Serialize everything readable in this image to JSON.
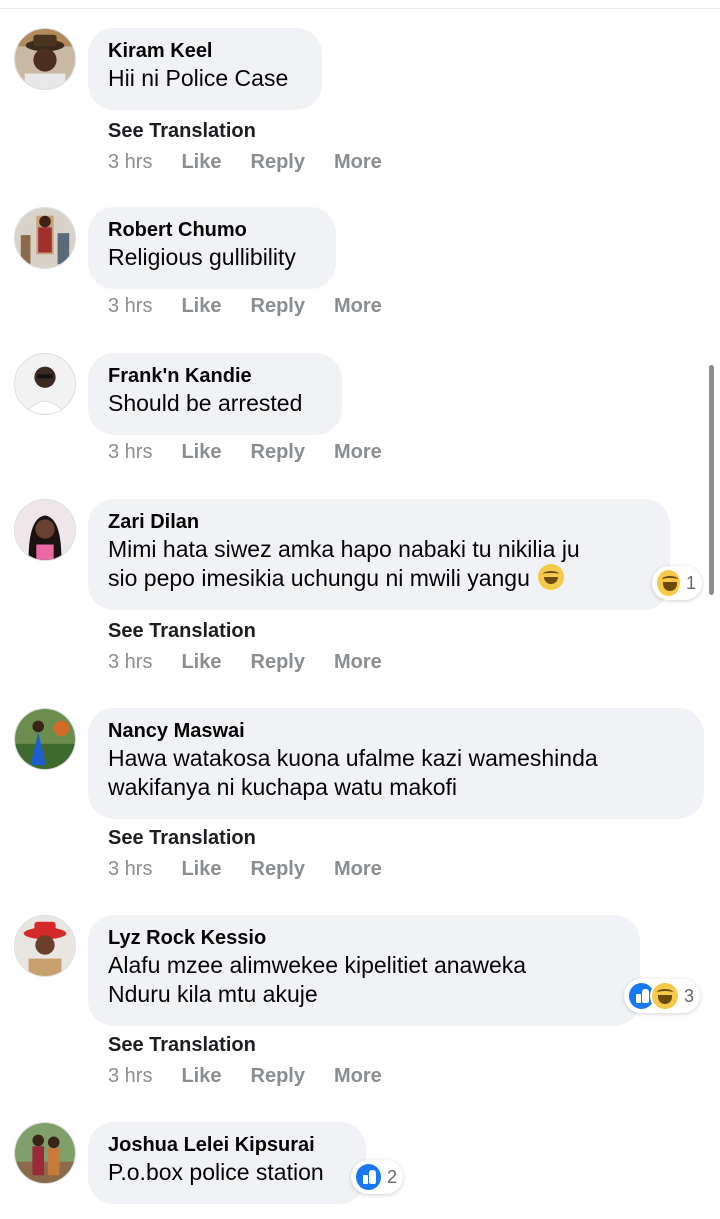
{
  "see_translation": "See Translation",
  "actions": {
    "time": "3 hrs",
    "like": "Like",
    "reply": "Reply",
    "more": "More"
  },
  "comments": [
    {
      "author": "Kiram Keel",
      "lines": [
        "Hii ni Police Case"
      ]
    },
    {
      "author": "Robert Chumo",
      "lines": [
        "Religious gullibility"
      ]
    },
    {
      "author": "Frank'n Kandie",
      "lines": [
        "Should be arrested"
      ]
    },
    {
      "author": "Zari Dilan",
      "lines": [
        "Mimi hata siwez amka hapo nabaki tu nikilia ju",
        "sio pepo imesikia uchungu ni mwili yangu"
      ],
      "emoji": "grinning-squinting-face",
      "reaction_count": "1"
    },
    {
      "author": "Nancy Maswai",
      "lines": [
        "Hawa watakosa kuona ufalme kazi wameshinda",
        "wakifanya ni kuchapa watu makofi"
      ]
    },
    {
      "author": "Lyz Rock Kessio",
      "lines": [
        "Alafu mzee alimwekee kipelitiet anaweka",
        "Nduru kila mtu akuje"
      ],
      "reaction_count": "3"
    },
    {
      "author": "Joshua Lelei Kipsurai",
      "lines": [
        "P.o.box police station"
      ],
      "reaction_count": "2"
    }
  ],
  "colors": {
    "bubble": "#f0f2f5",
    "meta": "#8a8d91",
    "like_blue": "#1877f2",
    "haha_yellow": "#f7c948"
  }
}
